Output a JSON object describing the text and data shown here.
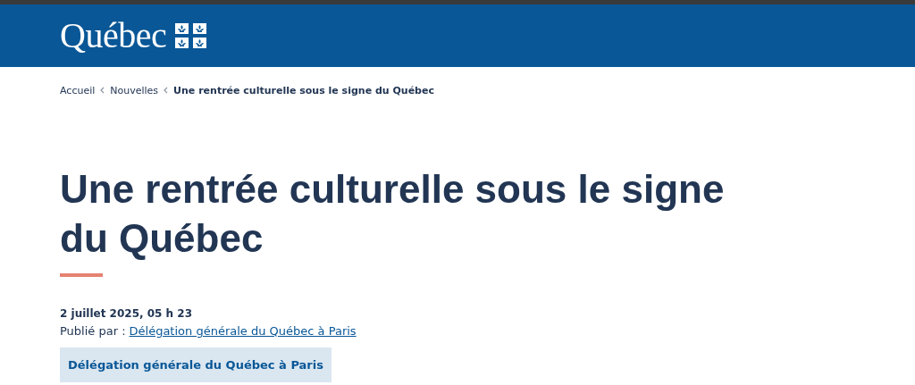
{
  "header": {
    "logo_text": "Québec"
  },
  "breadcrumb": [
    {
      "label": "Accueil",
      "current": false
    },
    {
      "label": "Nouvelles",
      "current": false
    },
    {
      "label": "Une rentrée culturelle sous le signe du Québec",
      "current": true
    }
  ],
  "article": {
    "title": "Une rentrée culturelle sous le signe du Québec",
    "date": "2 juillet 2025, 05 h 23",
    "published_by_label": "Publié par :",
    "publisher_link": "Délégation générale du Québec à Paris",
    "tag": "Délégation générale du Québec à Paris"
  }
}
